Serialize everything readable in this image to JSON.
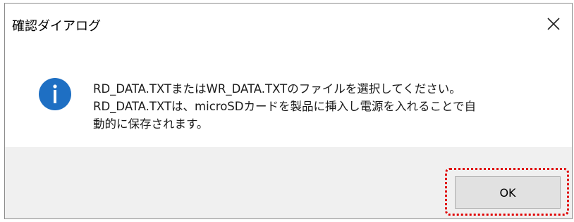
{
  "dialog": {
    "title": "確認ダイアログ",
    "close_icon": "close-icon",
    "message_icon": "info-icon",
    "message_lines": [
      "RD_DATA.TXTまたはWR_DATA.TXTのファイルを選択してください。",
      "RD_DATA.TXTは、microSDカードを製品に挿入し電源を入れることで自",
      "動的に保存されます。"
    ],
    "ok_label": "OK"
  },
  "colors": {
    "info_icon": "#1e6fc3",
    "highlight": "#e00000",
    "footer_bg": "#f0f0f0",
    "button_bg": "#e1e1e1"
  }
}
